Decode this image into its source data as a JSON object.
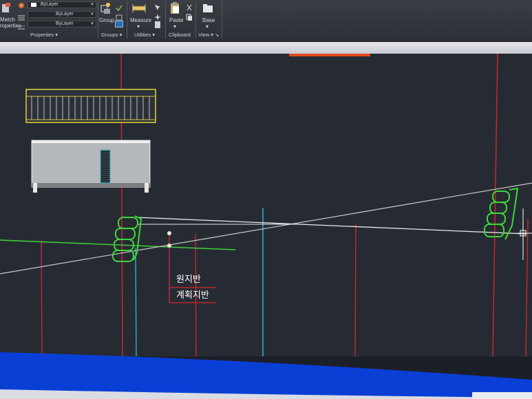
{
  "ribbon": {
    "match_properties_label": "Match\nProperties",
    "match_label_line1": "Match",
    "match_label_line2": "roperties",
    "layer_combo_1": "ByLayer",
    "layer_combo_2": "ByLayer",
    "layer_combo_3": "ByLayer",
    "properties_group": "Properties ▾",
    "group_button": "Group",
    "groups_group": "Groups ▾",
    "measure_button": "Measure",
    "utilities_group": "Utilities ▾",
    "paste_button": "Paste",
    "clipboard_group": "Clipboard",
    "base_button": "Base",
    "view_group": "View ▾ ↘"
  },
  "drawing": {
    "label_original_ground": "원지반",
    "label_planned_ground": "계획지반",
    "colors": {
      "background": "#262b33",
      "red_line": "#d7262e",
      "green_line": "#3ed838",
      "cyan_line": "#2fb9d4",
      "white_line": "#e6e6e6",
      "yellow_frame": "#d9c83a"
    }
  }
}
